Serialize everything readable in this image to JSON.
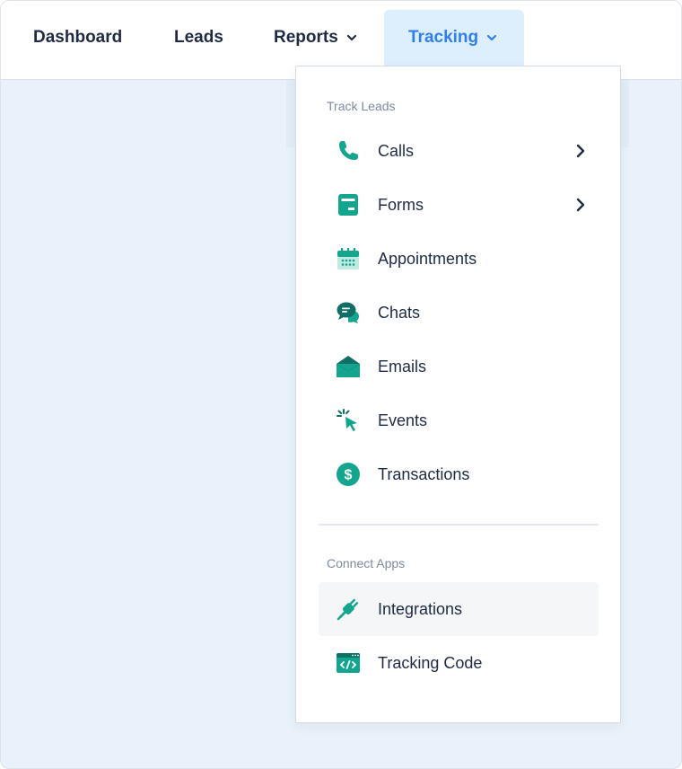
{
  "nav": {
    "dashboard": "Dashboard",
    "leads": "Leads",
    "reports": "Reports",
    "tracking": "Tracking"
  },
  "dropdown": {
    "track_leads_title": "Track Leads",
    "items": [
      {
        "label": "Calls",
        "icon": "phone-icon",
        "submenu": true
      },
      {
        "label": "Forms",
        "icon": "form-icon",
        "submenu": true
      },
      {
        "label": "Appointments",
        "icon": "calendar-icon",
        "submenu": false
      },
      {
        "label": "Chats",
        "icon": "chat-bubbles-icon",
        "submenu": false
      },
      {
        "label": "Emails",
        "icon": "envelope-icon",
        "submenu": false
      },
      {
        "label": "Events",
        "icon": "cursor-click-icon",
        "submenu": false
      },
      {
        "label": "Transactions",
        "icon": "dollar-coin-icon",
        "submenu": false
      }
    ],
    "connect_apps_title": "Connect Apps",
    "apps": [
      {
        "label": "Integrations",
        "icon": "plug-icon",
        "highlighted": true
      },
      {
        "label": "Tracking Code",
        "icon": "code-window-icon",
        "highlighted": false
      }
    ]
  },
  "colors": {
    "accent": "#2f80ed",
    "icon_green": "#14a58f",
    "icon_green_dark": "#0f7f6e",
    "text": "#1f2a44",
    "muted": "#7d8a9c",
    "background": "#e9f1fa"
  }
}
